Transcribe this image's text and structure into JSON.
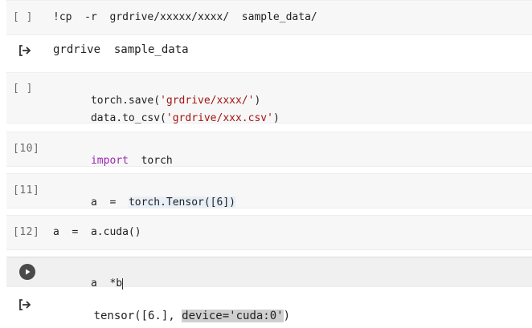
{
  "cells": [
    {
      "prompt": "[ ]",
      "lines": [
        "!cp  -r  grdrive/xxxxx/xxxx/  sample_data/"
      ]
    },
    {
      "output": "grdrive  sample_data"
    },
    {
      "prompt": "[ ]",
      "line1_a": "torch.save(",
      "line1_str": "'grdrive/xxxx/'",
      "line1_b": ")",
      "line2_a": "data.to_csv(",
      "line2_str": "'grdrive/xxx.csv'",
      "line2_b": ")"
    },
    {
      "prompt": "[10]",
      "kw": "import",
      "rest": "  torch"
    },
    {
      "prompt": "[11]",
      "pre": "a  =  ",
      "hl": "torch.Tensor([6])"
    },
    {
      "prompt": "[12]",
      "code": "a  =  a.cuda()"
    },
    {
      "code": "a  *b"
    },
    {
      "output_pre": "tensor([6.], ",
      "output_sel": "device='cuda:0'",
      "output_post": ")"
    }
  ]
}
